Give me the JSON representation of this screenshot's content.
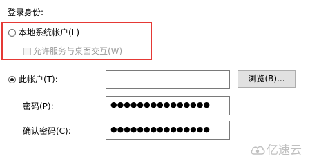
{
  "login_as": {
    "section_label": "登录身份:",
    "local_system": {
      "label": "本地系统帐户(L)",
      "selected": false,
      "interact_with_desktop": {
        "label": "允许服务与桌面交互(W)",
        "checked": false,
        "enabled": false
      }
    },
    "this_account": {
      "label": "此帐户(T):",
      "selected": true,
      "account_value": "",
      "browse_label": "浏览(B)...",
      "password_label": "密码(P):",
      "password_value": "●●●●●●●●●●●●●●●",
      "confirm_password_label": "确认密码(C):",
      "confirm_password_value": "●●●●●●●●●●●●●●●"
    }
  },
  "watermark": {
    "text": "亿速云",
    "icon": "cloud-logo-icon"
  },
  "colors": {
    "highlight_border": "#e53935",
    "disabled_text": "#9a9a9a",
    "button_bg": "#e1e1e1",
    "watermark_gray": "#c0c0c0"
  }
}
